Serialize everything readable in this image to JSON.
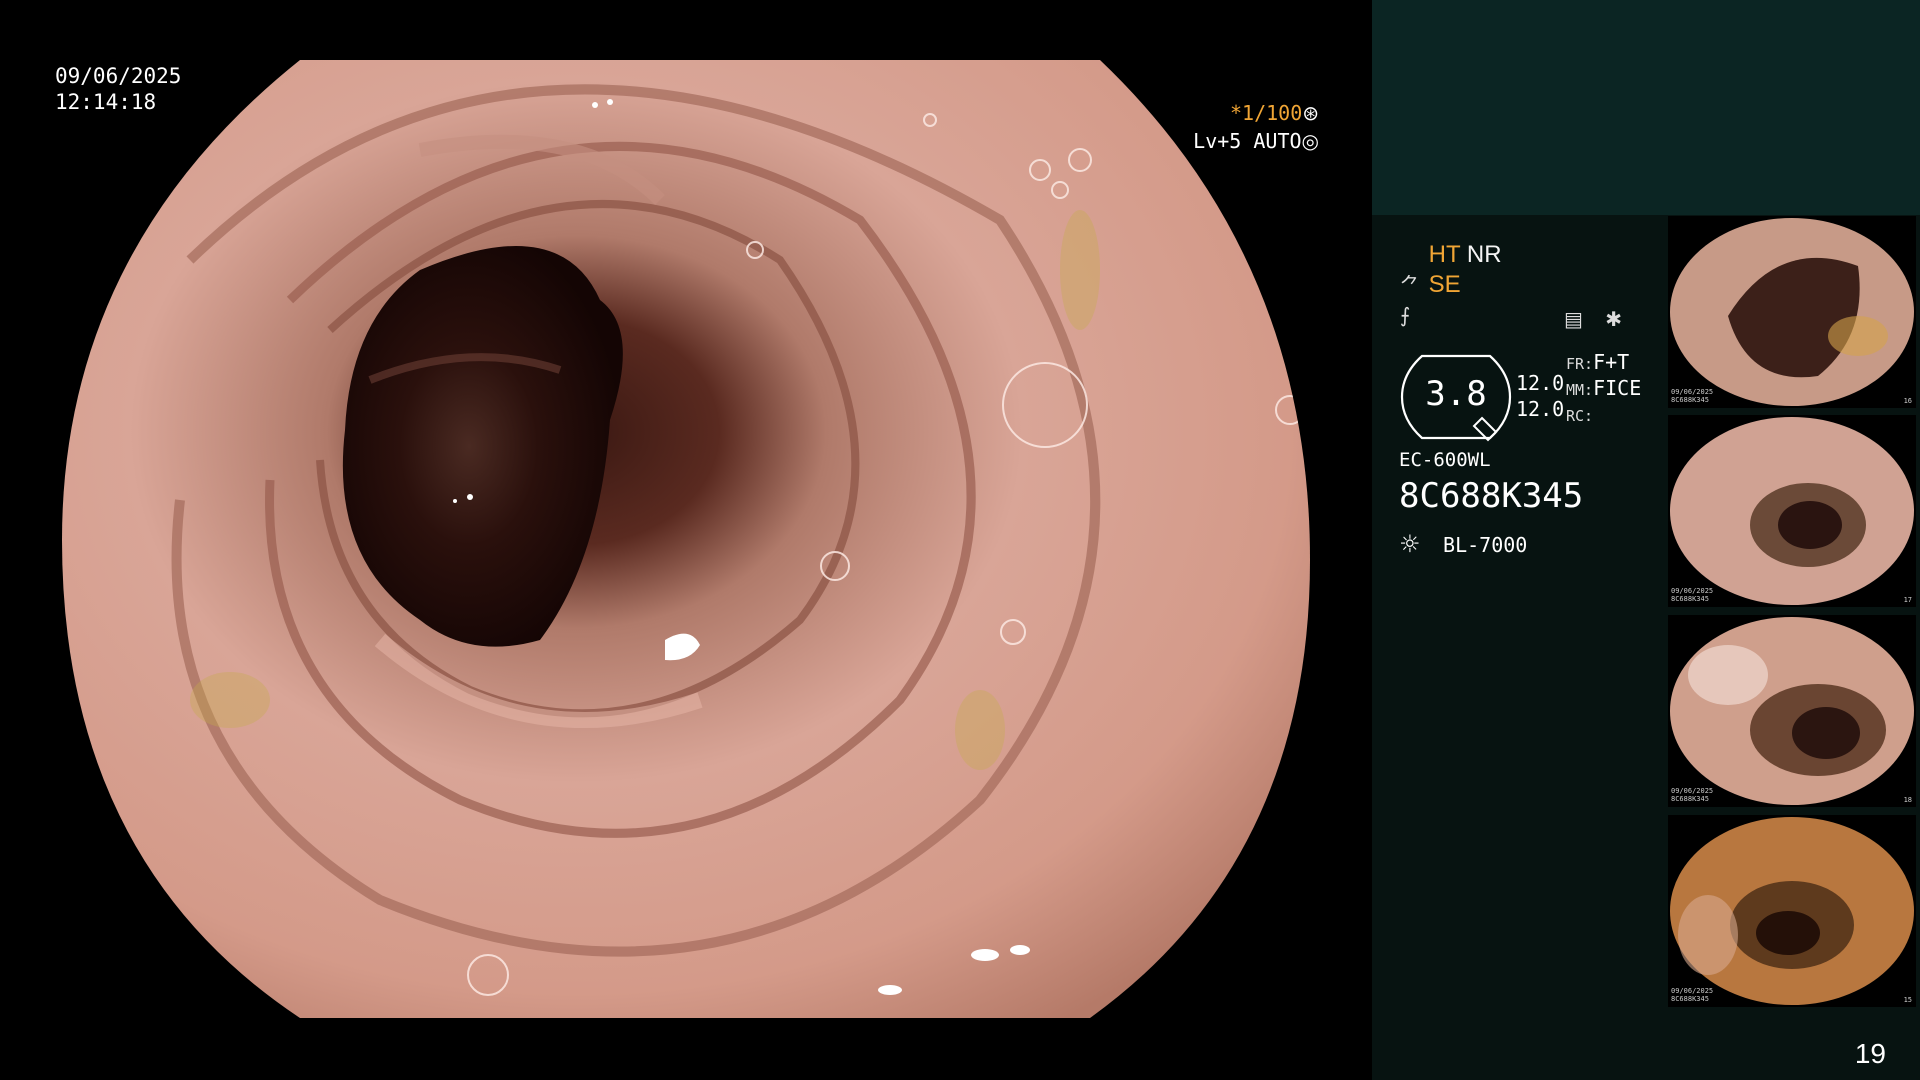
{
  "datetime": {
    "date": "09/06/2025",
    "time": "12:14:18"
  },
  "exposure": {
    "shutter": "*1/100",
    "level": "Lv+5 AUTO"
  },
  "processing": {
    "row1": {
      "ht": "HT",
      "nr": "NR"
    },
    "row2": {
      "se": "SE"
    }
  },
  "zoom": {
    "value": "3.8",
    "num1": "12.0",
    "num2": "12.0",
    "fr_label": "FR:",
    "fr_value": "F+T",
    "mm_label": "MM:",
    "mm_value": "FICE",
    "rc_label": "RC:"
  },
  "scope": {
    "model": "EC-600WL",
    "serial": "8C688K345"
  },
  "light_source": {
    "name": "BL-7000",
    "icon": "light-bulb-icon"
  },
  "thumbnails": [
    {
      "label_top": "09/06/2025",
      "label_bottom": "8C688K345",
      "num": "16"
    },
    {
      "label_top": "09/06/2025",
      "label_bottom": "8C688K345",
      "num": "17"
    },
    {
      "label_top": "09/06/2025",
      "label_bottom": "8C688K345",
      "num": "18"
    },
    {
      "label_top": "09/06/2025",
      "label_bottom": "8C688K345",
      "num": "15"
    }
  ],
  "page_number": "19",
  "colors": {
    "accent_orange": "#f0a535",
    "panel_dark": "#071311",
    "panel_teal": "#0b2523"
  }
}
